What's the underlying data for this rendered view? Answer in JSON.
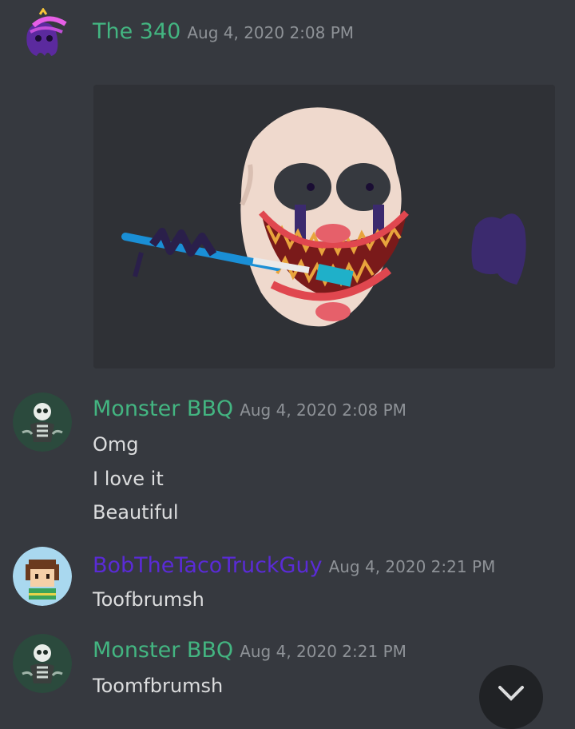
{
  "colors": {
    "bg": "#36393f",
    "green": "#43b581",
    "purple": "#5a2bd6",
    "muted": "#8e9297",
    "text": "#dcddde"
  },
  "messages": [
    {
      "author": "The 340",
      "time": "Aug 4, 2020 2:08 PM",
      "author_color": "#43b581",
      "avatar_icon": "purple-ghost-avatar-icon"
    },
    {
      "author": "Monster BBQ",
      "time": "Aug 4, 2020 2:08 PM",
      "author_color": "#43b581",
      "avatar_icon": "skeleton-avatar-icon",
      "lines": [
        "Omg",
        "I love it",
        "Beautiful"
      ]
    },
    {
      "author": "BobTheTacoTruckGuy",
      "time": "Aug 4, 2020 2:21 PM",
      "author_color": "#5a2bd6",
      "avatar_icon": "pixel-boy-avatar-icon",
      "lines": [
        "Toofbrumsh"
      ]
    },
    {
      "author": "Monster BBQ",
      "time": "Aug 4, 2020 2:21 PM",
      "author_color": "#43b581",
      "avatar_icon": "skeleton-avatar-icon",
      "lines": [
        "Toomfbrumsh"
      ]
    }
  ],
  "attachment_icon": "mask-with-toothbrush-image",
  "scroll_icon": "chevron-down-icon"
}
